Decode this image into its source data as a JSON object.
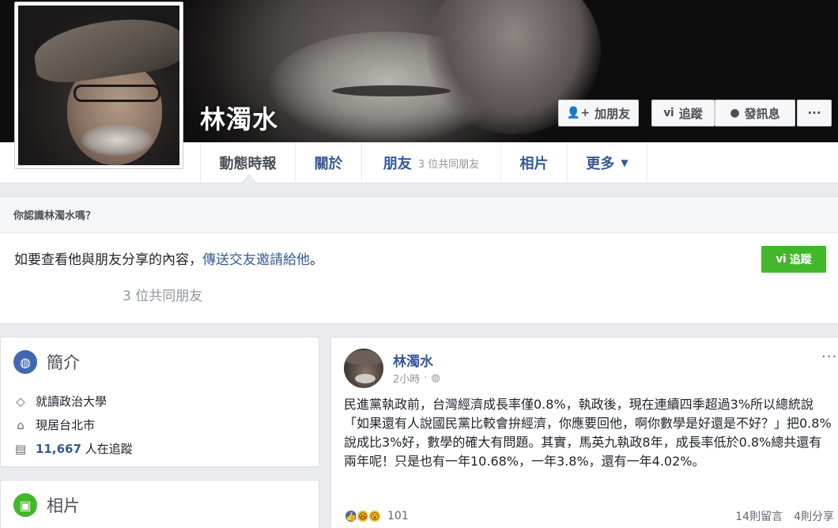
{
  "profile": {
    "name": "林濁水"
  },
  "cover_actions": {
    "add_friend": "加朋友",
    "follow": "追蹤",
    "message": "發訊息",
    "more": "···"
  },
  "nav": {
    "timeline": "動態時報",
    "about": "關於",
    "friends": "朋友",
    "friends_sub": "3 位共同朋友",
    "photos": "相片",
    "more": "更多"
  },
  "know_box": {
    "title": "你認識林濁水嗎？",
    "line_prefix": "如要查看他與朋友分享的內容，",
    "line_link": "傳送交友邀請給他",
    "line_suffix": "。",
    "mutual": "3 位共同朋友",
    "follow_button": "追蹤"
  },
  "intro": {
    "title": "簡介",
    "education": "就讀政治大學",
    "residence": "現居台北市",
    "followers_count": "11,667",
    "followers_label": "人在追蹤"
  },
  "photos_card": {
    "title": "相片"
  },
  "post": {
    "author": "林濁水",
    "time": "2小時",
    "text": "民進黨執政前，台灣經濟成長率僅0.8%，執政後，現在連續四季超過3%所以總統說「如果還有人說國民黨比較會拚經濟，你應要回他，啊你數學是好還是不好？」把0.8%說成比3%好，數學的確大有問題。其實，馬英九執政8年，成長率低於0.8%總共還有兩年呢！只是也有一年10.68%，一年3.8%，還有一年4.02%。",
    "reactions_count": "101",
    "comments": "14則留言",
    "shares": "4則分享",
    "more": "···"
  },
  "icons": {
    "add_friend": "person-plus-icon",
    "follow": "rss-icon",
    "message": "messenger-icon",
    "intro": "globe-icon",
    "education": "graduation-cap-icon",
    "residence": "house-icon",
    "followers": "rss-card-icon",
    "photos": "photo-icon",
    "privacy": "globe-small-icon"
  },
  "colors": {
    "link": "#365899",
    "follow_green": "#42b72a",
    "like_blue": "#4267b2"
  }
}
